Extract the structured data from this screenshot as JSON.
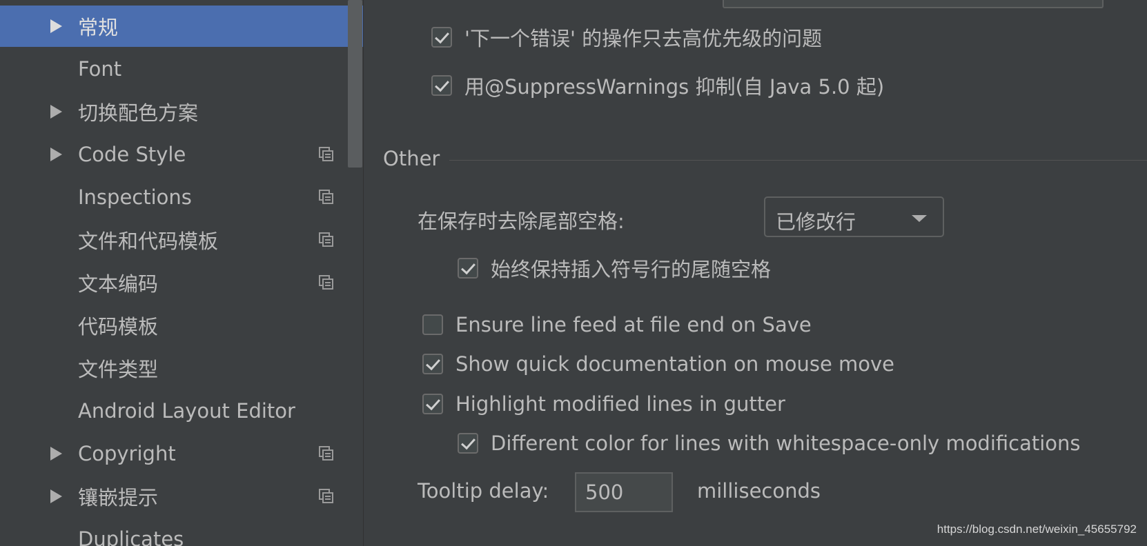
{
  "sidebar": {
    "items": [
      {
        "label": "常规",
        "arrow": true,
        "copy_icon": false,
        "selected": true
      },
      {
        "label": "Font",
        "arrow": false,
        "copy_icon": false,
        "selected": false
      },
      {
        "label": "切换配色方案",
        "arrow": true,
        "copy_icon": false,
        "selected": false
      },
      {
        "label": "Code Style",
        "arrow": true,
        "copy_icon": true,
        "selected": false
      },
      {
        "label": "Inspections",
        "arrow": false,
        "copy_icon": true,
        "selected": false
      },
      {
        "label": "文件和代码模板",
        "arrow": false,
        "copy_icon": true,
        "selected": false
      },
      {
        "label": "文本编码",
        "arrow": false,
        "copy_icon": true,
        "selected": false
      },
      {
        "label": "代码模板",
        "arrow": false,
        "copy_icon": false,
        "selected": false
      },
      {
        "label": "文件类型",
        "arrow": false,
        "copy_icon": false,
        "selected": false
      },
      {
        "label": "Android Layout Editor",
        "arrow": false,
        "copy_icon": false,
        "selected": false
      },
      {
        "label": "Copyright",
        "arrow": true,
        "copy_icon": true,
        "selected": false
      },
      {
        "label": "镶嵌提示",
        "arrow": true,
        "copy_icon": true,
        "selected": false
      },
      {
        "label": "Duplicates",
        "arrow": false,
        "copy_icon": false,
        "selected": false
      }
    ]
  },
  "main": {
    "checkboxes_top": [
      {
        "label": "'下一个错误' 的操作只去高优先级的问题",
        "checked": true
      },
      {
        "label": "用@SuppressWarnings 抑制(自 Java 5.0 起)",
        "checked": true
      }
    ],
    "other_section": {
      "title": "Other",
      "strip_trailing_label": "在保存时去除尾部空格:",
      "strip_trailing_value": "已修改行",
      "keep_caret_label": "始终保持插入符号行的尾随空格",
      "keep_caret_checked": true,
      "ensure_line_feed_label": "Ensure line feed at file end on Save",
      "ensure_line_feed_checked": false,
      "quick_doc_label": "Show quick documentation on mouse move",
      "quick_doc_checked": true,
      "highlight_modified_label": "Highlight modified lines in gutter",
      "highlight_modified_checked": true,
      "whitespace_color_label": "Different color for lines with whitespace-only modifications",
      "whitespace_color_checked": true,
      "tooltip_delay_label": "Tooltip delay:",
      "tooltip_delay_value": "500",
      "tooltip_delay_unit": "milliseconds"
    }
  },
  "watermark": "https://blog.csdn.net/weixin_45655792",
  "colors": {
    "background": "#3c3f41",
    "selection": "#4b6eaf",
    "text": "#bbbbbb"
  }
}
